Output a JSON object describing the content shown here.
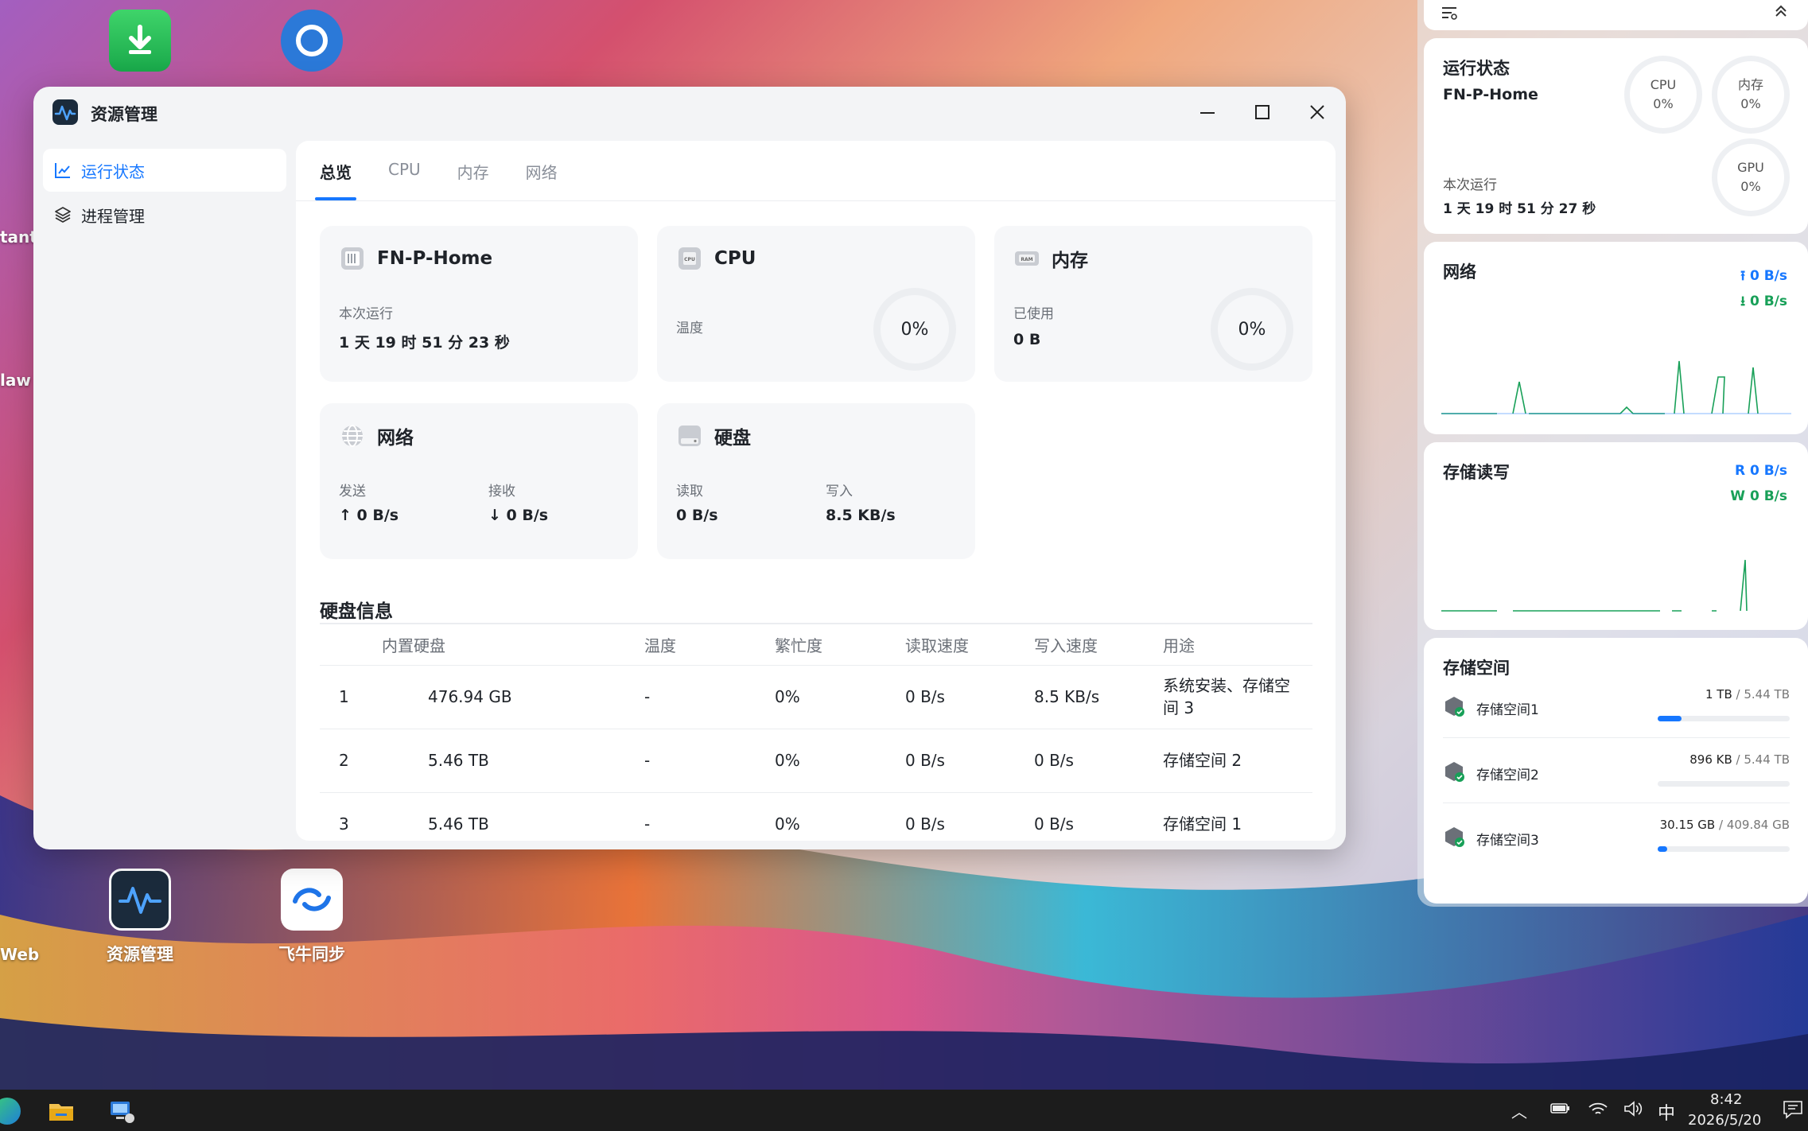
{
  "desktop": {
    "icons": [
      {
        "label": "资源管理"
      },
      {
        "label": "飞牛同步"
      }
    ],
    "edge_labels": [
      "tant",
      "law",
      "Web"
    ]
  },
  "window": {
    "title": "资源管理",
    "sidebar": [
      {
        "label": "运行状态",
        "active": true
      },
      {
        "label": "进程管理",
        "active": false
      }
    ],
    "tabs": [
      {
        "label": "总览",
        "active": true
      },
      {
        "label": "CPU",
        "active": false
      },
      {
        "label": "内存",
        "active": false
      },
      {
        "label": "网络",
        "active": false
      }
    ],
    "cards": {
      "host": {
        "title": "FN-P-Home",
        "uptime_label": "本次运行",
        "uptime": "1 天 19 时 51 分 23 秒"
      },
      "cpu": {
        "title": "CPU",
        "temp_label": "温度",
        "usage": "0%"
      },
      "memory": {
        "title": "内存",
        "used_label": "已使用",
        "used": "0 B",
        "usage": "0%"
      },
      "network": {
        "title": "网络",
        "send_label": "发送",
        "send": "0 B/s",
        "recv_label": "接收",
        "recv": "0 B/s"
      },
      "disk": {
        "title": "硬盘",
        "read_label": "读取",
        "read": "0 B/s",
        "write_label": "写入",
        "write": "8.5 KB/s"
      }
    },
    "disk_info": {
      "title": "硬盘信息",
      "columns": [
        "内置硬盘",
        "温度",
        "繁忙度",
        "读取速度",
        "写入速度",
        "用途"
      ],
      "rows": [
        {
          "no": "1",
          "size": "476.94 GB",
          "temp": "-",
          "busy": "0%",
          "read": "0 B/s",
          "write": "8.5 KB/s",
          "usage": "系统安装、存储空间 3"
        },
        {
          "no": "2",
          "size": "5.46 TB",
          "temp": "-",
          "busy": "0%",
          "read": "0 B/s",
          "write": "0 B/s",
          "usage": "存储空间 2"
        },
        {
          "no": "3",
          "size": "5.46 TB",
          "temp": "-",
          "busy": "0%",
          "read": "0 B/s",
          "write": "0 B/s",
          "usage": "存储空间 1"
        }
      ]
    }
  },
  "panel": {
    "status": {
      "title": "运行状态",
      "host": "FN-P-Home",
      "uptime_label": "本次运行",
      "uptime": "1 天 19 时 51 分 27 秒",
      "cpu_label": "CPU",
      "cpu": "0%",
      "mem_label": "内存",
      "mem": "0%",
      "gpu_label": "GPU",
      "gpu": "0%"
    },
    "network": {
      "title": "网络",
      "up": "0 B/s",
      "down": "0 B/s"
    },
    "io": {
      "title": "存储读写",
      "read_prefix": "R",
      "read": "0 B/s",
      "write_prefix": "W",
      "write": "0 B/s"
    },
    "storage": {
      "title": "存储空间",
      "items": [
        {
          "name": "存储空间1",
          "used": "1 TB",
          "total": "/ 5.44 TB",
          "fraction": 0.18
        },
        {
          "name": "存储空间2",
          "used": "896 KB",
          "total": "/ 5.44 TB",
          "fraction": 0.0
        },
        {
          "name": "存储空间3",
          "used": "30.15 GB",
          "total": "/ 409.84 GB",
          "fraction": 0.07
        }
      ]
    }
  },
  "taskbar": {
    "ime": "中",
    "time": "8:42",
    "date": "2026/5/20"
  },
  "colors": {
    "accent": "#1677ff",
    "green": "#18a058"
  }
}
